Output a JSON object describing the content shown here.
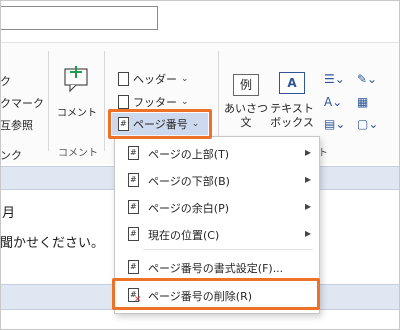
{
  "title_field": {
    "value": ""
  },
  "ribbon": {
    "left_partial": [
      "ク",
      "クマーク",
      "互参照",
      "ンク"
    ],
    "comment_button": "コメント",
    "comment_group": "コメント",
    "header_button": "ヘッダー",
    "footer_button": "フッター",
    "page_number_button": "ページ番号",
    "text_box": {
      "line1": "あいさつ",
      "line2": "文"
    },
    "text_box2": {
      "line1": "テキスト",
      "line2": "ボックス"
    },
    "example_tile": "例",
    "a_tile": "A",
    "group_tail_label": "ト"
  },
  "document": {
    "line1": "月",
    "line2": "聞かせください。"
  },
  "menu": {
    "items": [
      {
        "label": "ページの上部(T)",
        "submenu": true
      },
      {
        "label": "ページの下部(B)",
        "submenu": true
      },
      {
        "label": "ページの余白(P)",
        "submenu": true
      },
      {
        "label": "現在の位置(C)",
        "submenu": true
      },
      {
        "label": "ページ番号の書式設定(F)...",
        "submenu": false
      },
      {
        "label": "ページ番号の削除(R)",
        "submenu": false
      }
    ]
  },
  "colors": {
    "highlight": "#ed7228",
    "selected": "#cdd9ee",
    "accent": "#2f5597"
  },
  "icons": {
    "arrow": "▸",
    "chev": "⌄",
    "comment": "plus-comment-icon",
    "remove": "remove-page-number-icon"
  }
}
